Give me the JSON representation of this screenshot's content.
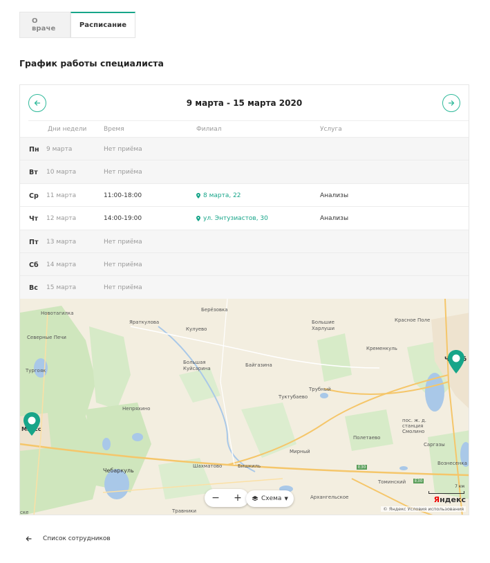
{
  "tabs": [
    {
      "label": "О враче",
      "active": false
    },
    {
      "label": "Расписание",
      "active": true
    }
  ],
  "section_title": "График работы специалиста",
  "schedule": {
    "week_title": "9 марта - 15 марта 2020",
    "prev_icon": "arrow-left-icon",
    "next_icon": "arrow-right-icon",
    "columns": [
      "Дни недели",
      "Время",
      "Филиал",
      "Услуга"
    ],
    "rows": [
      {
        "day": "Пн",
        "date": "9 марта",
        "time": "Нет приёма",
        "branch": "",
        "service": ""
      },
      {
        "day": "Вт",
        "date": "10 марта",
        "time": "Нет приёма",
        "branch": "",
        "service": ""
      },
      {
        "day": "Ср",
        "date": "11 марта",
        "time": "11:00-18:00",
        "branch": "8 марта, 22",
        "service": "Анализы"
      },
      {
        "day": "Чт",
        "date": "12 марта",
        "time": "14:00-19:00",
        "branch": "ул. Энтузиастов, 30",
        "service": "Анализы"
      },
      {
        "day": "Пт",
        "date": "13 марта",
        "time": "Нет приёма",
        "branch": "",
        "service": ""
      },
      {
        "day": "Сб",
        "date": "14 марта",
        "time": "Нет приёма",
        "branch": "",
        "service": ""
      },
      {
        "day": "Вс",
        "date": "15 марта",
        "time": "Нет приёма",
        "branch": "",
        "service": ""
      }
    ]
  },
  "map": {
    "labels": {
      "novotagilka": "Новотагилка",
      "beryozovka": "Берёзовка",
      "yaraktulova": "Яраткулова",
      "kulueva": "Кулуево",
      "bolshie_kharlushi": "Большие Харлуши",
      "krasnoe_pole": "Красное Поле",
      "severnye_pechi": "Северные Печи",
      "kremenkul": "Кременкуль",
      "turgoyak": "Тургояк",
      "bolshaya_kuysarina": "Большая Куйсарина",
      "baygazina": "Байгазина",
      "trubny": "Трубный",
      "tuktubaevo": "Туктубаево",
      "nepryakhino": "Непряхино",
      "miass": "Миасс",
      "chelyabinsk": "Челяб",
      "poletaevo": "Полетаево",
      "station_smolino": "пос. ж. д. станция Смолино",
      "mirny": "Мирный",
      "sargazy": "Саргазы",
      "chebarkul": "Чебаркуль",
      "shakhmatovo": "Шахматово",
      "bishkil": "Бишкиль",
      "e30_a": "E30",
      "e30_b": "E30",
      "tominsky": "Томинский",
      "voznesenka": "Вознесенка",
      "arkhangelskoe": "Архангельское",
      "travniki": "Травники",
      "sk": "ске"
    },
    "zoom_out": "−",
    "zoom_in": "+",
    "layers_label": "Схема",
    "scale_label": "7 км",
    "logo_y": "Я",
    "logo_rest": "ндекс",
    "attribution": "© Яндекс  Условия использования"
  },
  "back_link": "Список сотрудников",
  "colors": {
    "accent": "#17a589"
  }
}
